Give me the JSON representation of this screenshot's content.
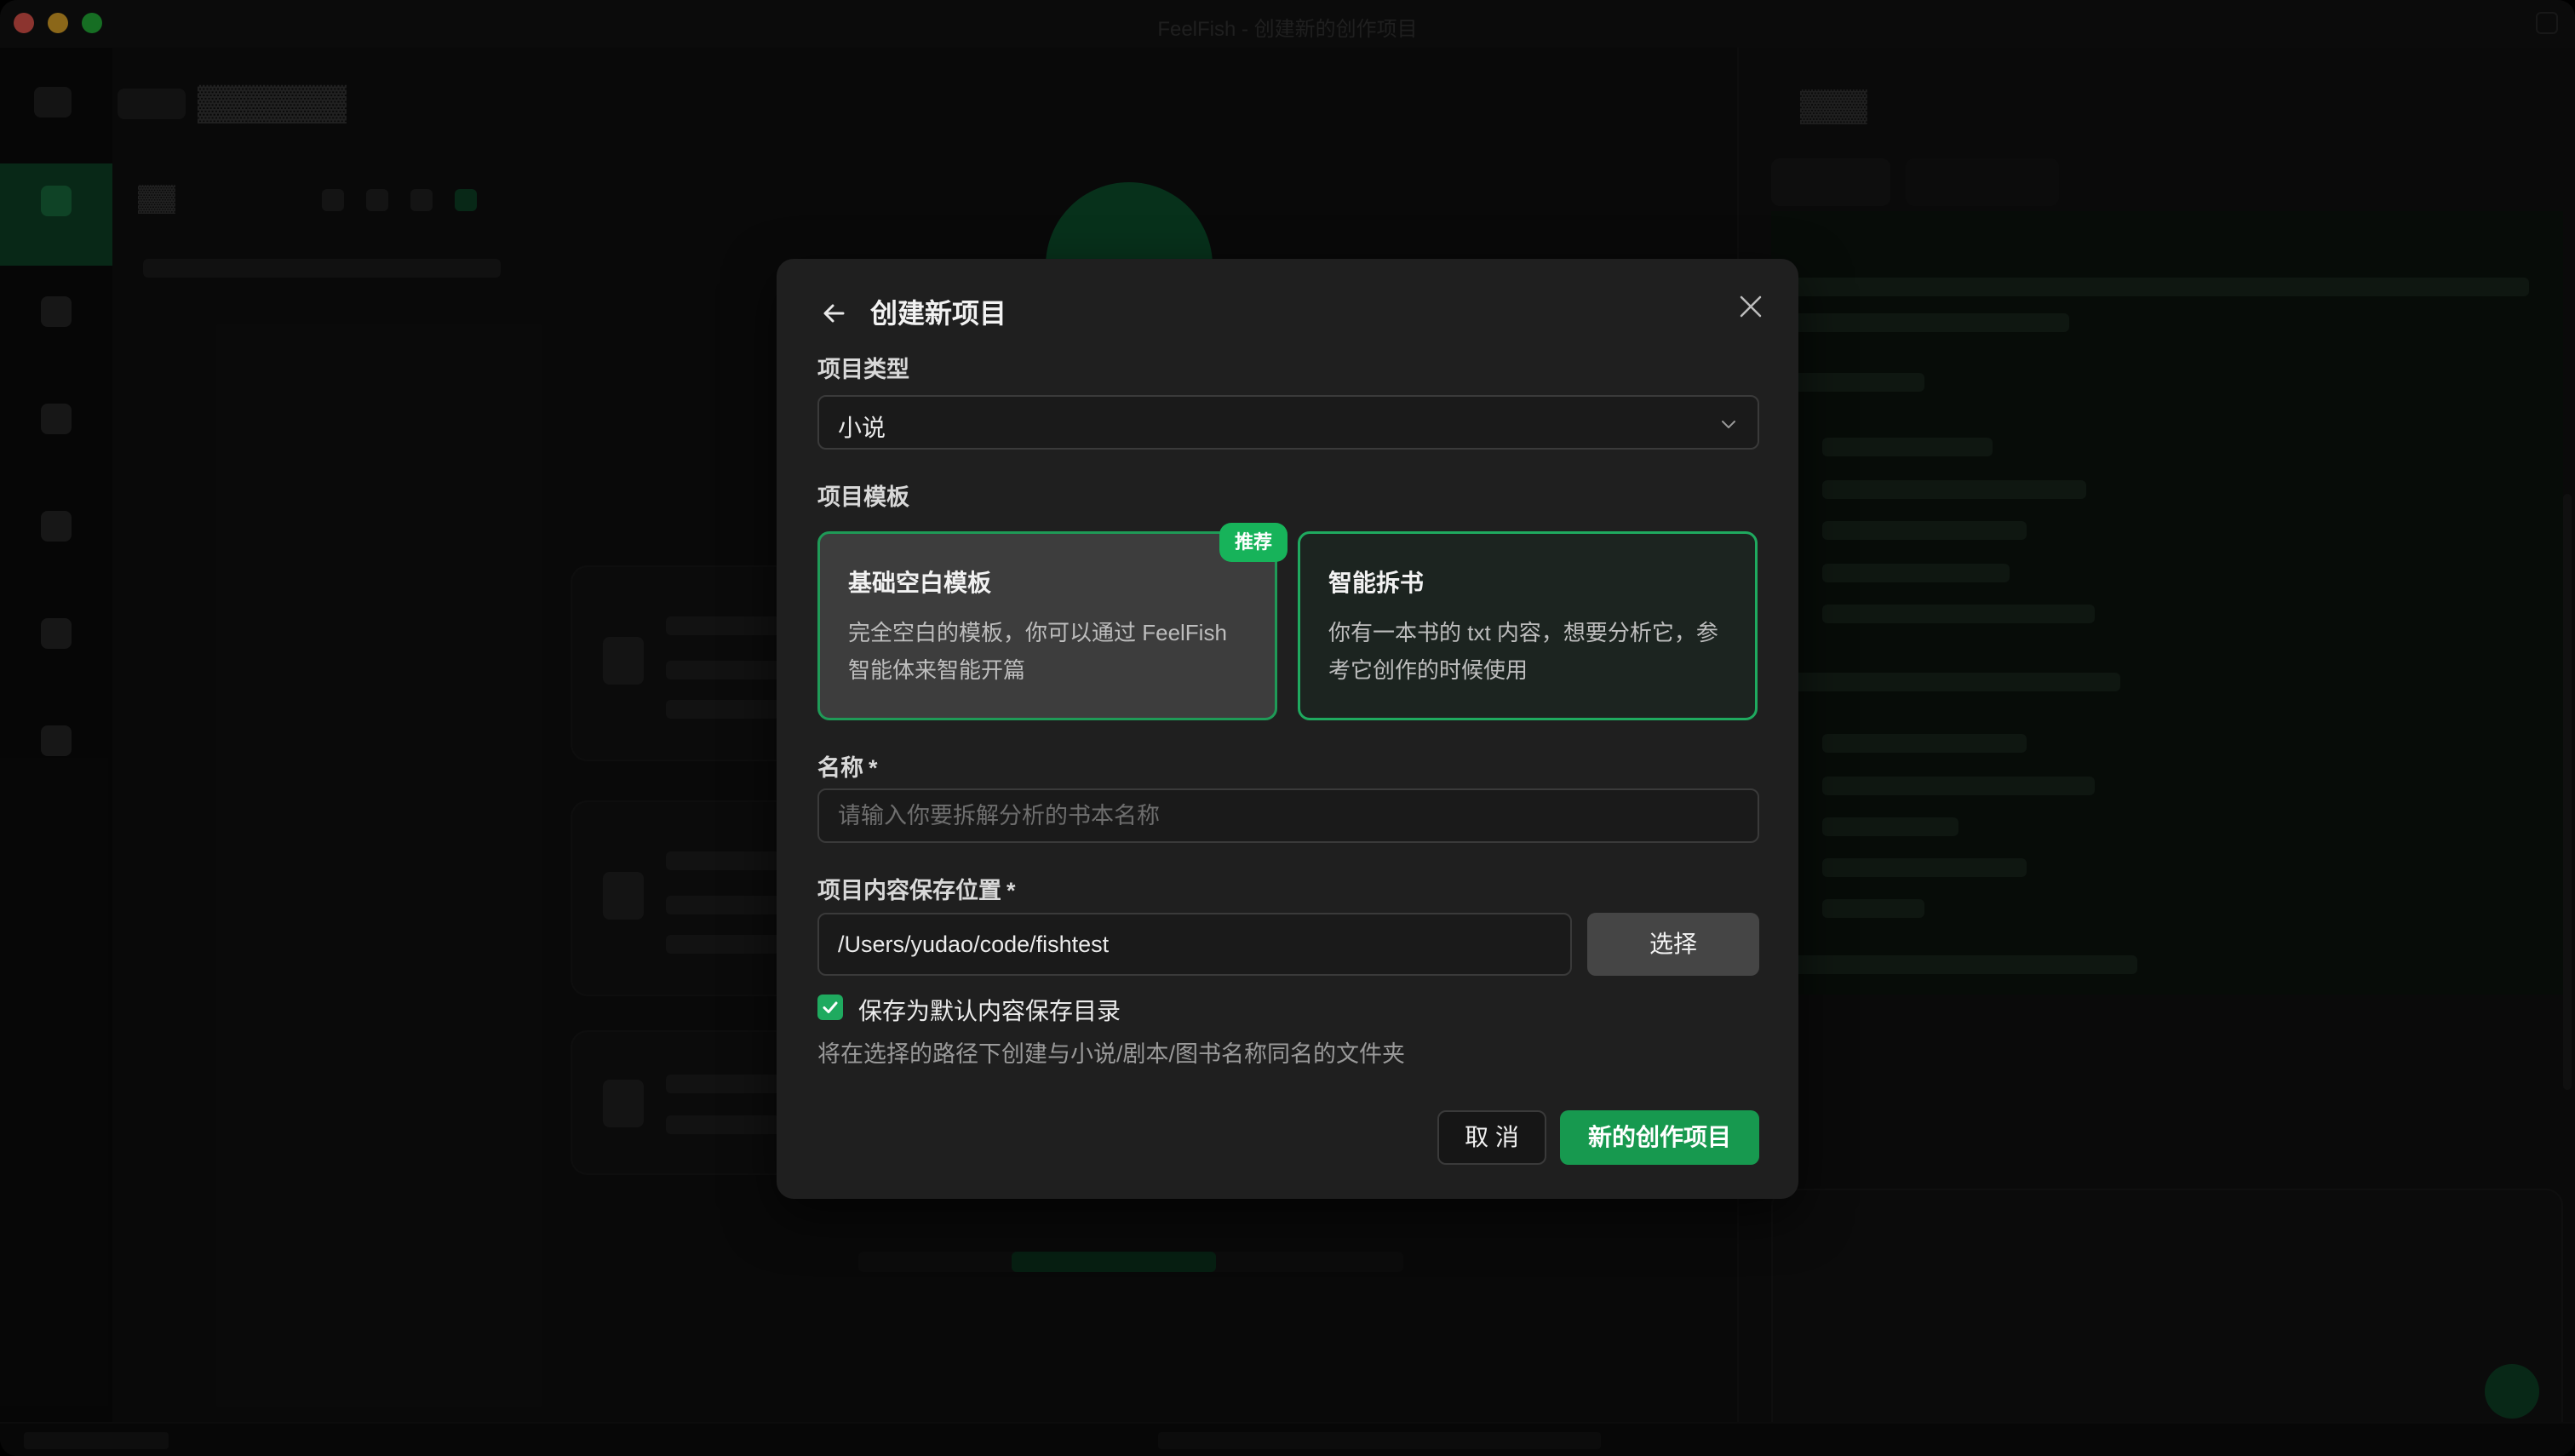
{
  "window": {
    "title": "FeelFish - 创建新的创作项目"
  },
  "modal": {
    "title": "创建新项目",
    "project_type": {
      "label": "项目类型",
      "value": "小说"
    },
    "project_template": {
      "label": "项目模板",
      "badge": "推荐",
      "templates": [
        {
          "title": "基础空白模板",
          "description": "完全空白的模板，你可以通过 FeelFish 智能体来智能开篇",
          "selected": true
        },
        {
          "title": "智能拆书",
          "description": "你有一本书的 txt 内容，想要分析它，参考它创作的时候使用",
          "selected": false
        }
      ]
    },
    "name_field": {
      "label": "名称",
      "required_mark": "*",
      "placeholder": "请输入你要拆解分析的书本名称",
      "value": ""
    },
    "save_location": {
      "label": "项目内容保存位置",
      "required_mark": "*",
      "value": "/Users/yudao/code/fishtest",
      "choose_label": "选择"
    },
    "default_dir_checkbox": {
      "label": "保存为默认内容保存目录",
      "checked": true
    },
    "hint": "将在选择的路径下创建与小说/剧本/图书名称同名的文件夹",
    "cancel_label": "取 消",
    "create_label": "新的创作项目"
  },
  "colors": {
    "accent": "#17994f",
    "badge": "#17b35a",
    "modal_bg": "#1f1f1f",
    "selected_card_bg": "#3d3d3d"
  },
  "icons": {
    "back": "arrow-left-icon",
    "close": "close-icon",
    "dropdown": "chevron-down-icon",
    "checkbox": "checkmark-icon"
  }
}
